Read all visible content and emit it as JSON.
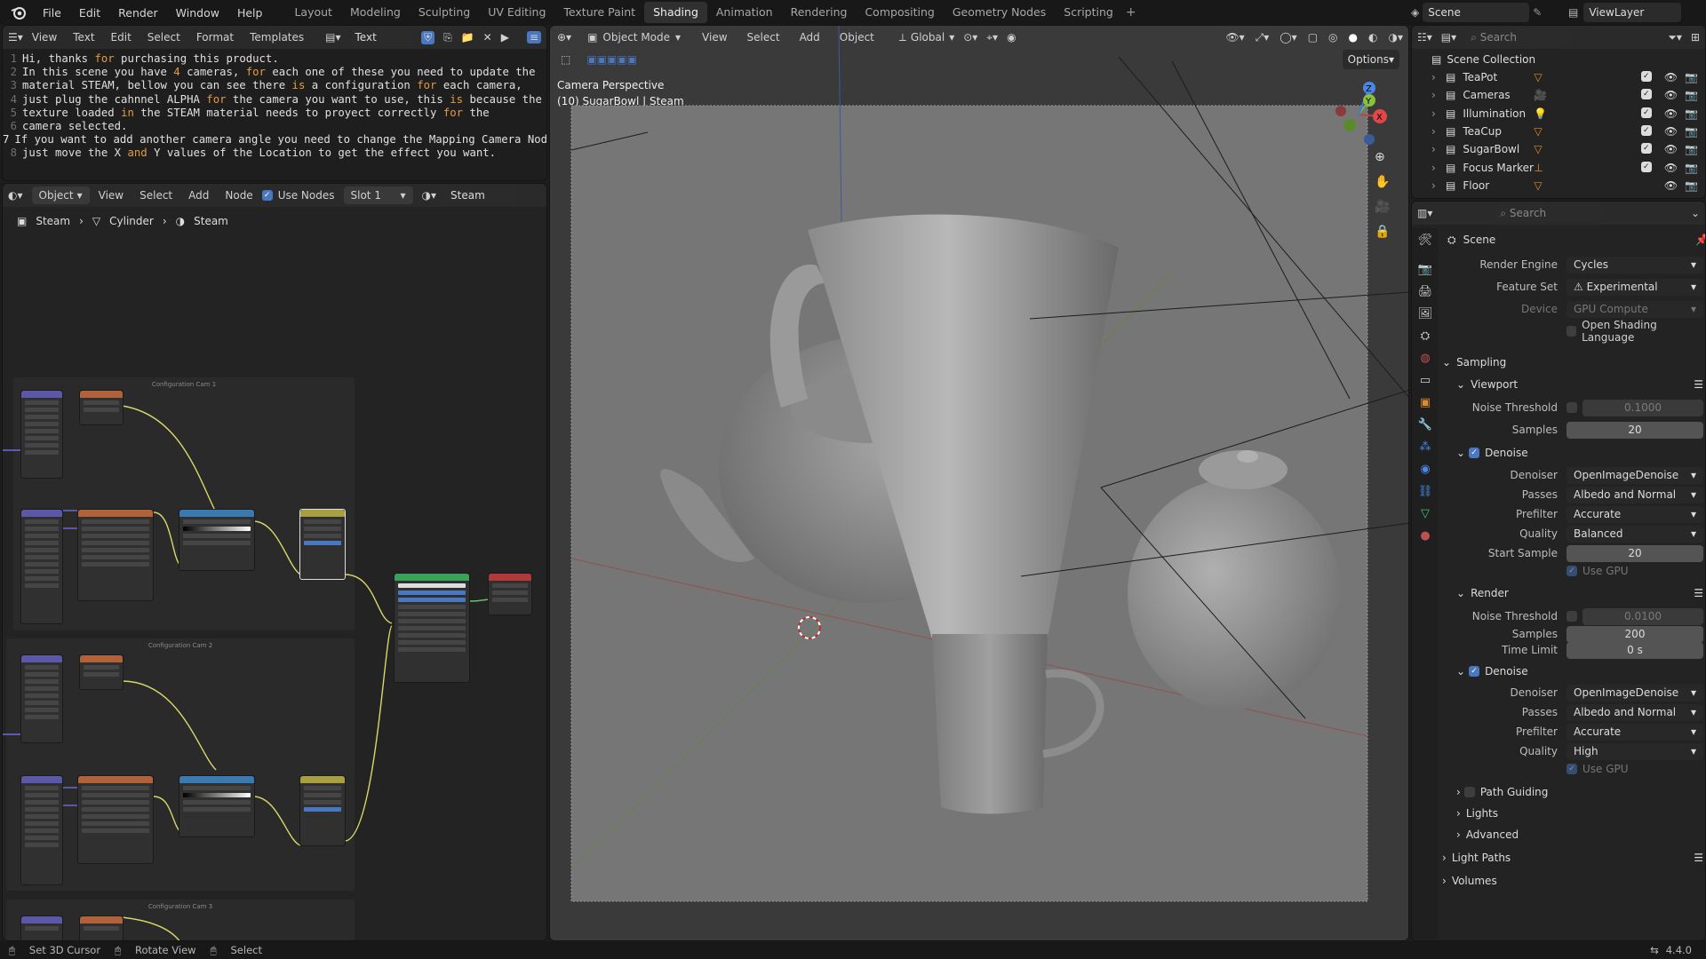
{
  "top_menu": [
    "File",
    "Edit",
    "Render",
    "Window",
    "Help"
  ],
  "workspaces": [
    "Layout",
    "Modeling",
    "Sculpting",
    "UV Editing",
    "Texture Paint",
    "Shading",
    "Animation",
    "Rendering",
    "Compositing",
    "Geometry Nodes",
    "Scripting"
  ],
  "active_workspace": "Shading",
  "scene_name": "Scene",
  "view_layer": "ViewLayer",
  "text_editor": {
    "menu": [
      "View",
      "Text",
      "Edit",
      "Select",
      "Format",
      "Templates"
    ],
    "datablock": "Text",
    "lines": [
      {
        "n": "1",
        "segments": [
          {
            "t": "Hi, thanks "
          },
          {
            "t": "for",
            "k": true
          },
          {
            "t": " purchasing this product."
          }
        ]
      },
      {
        "n": "2",
        "segments": [
          {
            "t": "In this scene you have "
          },
          {
            "t": "4",
            "k": true
          },
          {
            "t": " cameras, "
          },
          {
            "t": "for",
            "k": true
          },
          {
            "t": " each one of these you need to update the"
          }
        ]
      },
      {
        "n": "3",
        "segments": [
          {
            "t": "material STEAM, bellow you can see there "
          },
          {
            "t": "is",
            "k": true
          },
          {
            "t": " a configuration "
          },
          {
            "t": "for",
            "k": true
          },
          {
            "t": " each camera,"
          }
        ]
      },
      {
        "n": "4",
        "segments": [
          {
            "t": "just plug the cahnnel ALPHA "
          },
          {
            "t": "for",
            "k": true
          },
          {
            "t": " the camera you want to use, this "
          },
          {
            "t": "is",
            "k": true
          },
          {
            "t": " because the"
          }
        ]
      },
      {
        "n": "5",
        "segments": [
          {
            "t": "texture loaded "
          },
          {
            "t": "in",
            "k": true
          },
          {
            "t": " the STEAM material needs to proyect correctly "
          },
          {
            "t": "for",
            "k": true
          },
          {
            "t": " the"
          }
        ]
      },
      {
        "n": "6",
        "segments": [
          {
            "t": "camera selected."
          }
        ]
      },
      {
        "n": "7",
        "segments": [
          {
            "t": "If you want to add another camera angle you need to change the Mapping Camera Node"
          }
        ],
        "current": true
      },
      {
        "n": "8",
        "segments": [
          {
            "t": "just move the X "
          },
          {
            "t": "and",
            "k": true
          },
          {
            "t": " Y values of the Location to get the effect you want."
          }
        ]
      }
    ]
  },
  "node_editor": {
    "header": {
      "mode": "Object",
      "menu": [
        "View",
        "Select",
        "Add",
        "Node"
      ],
      "use_nodes_label": "Use Nodes",
      "slot": "Slot 1",
      "material": "Steam"
    },
    "breadcrumb": [
      "Steam",
      "Cylinder",
      "Steam"
    ],
    "frames": [
      "Configuration Cam 1",
      "Configuration Cam 2",
      "Configuration Cam 3"
    ]
  },
  "viewport": {
    "mode": "Object Mode",
    "menu": [
      "View",
      "Select",
      "Add",
      "Object"
    ],
    "orientation": "Global",
    "options_label": "Options",
    "overlay_title": "Camera Perspective",
    "overlay_subtitle": "(10) SugarBowl | Steam"
  },
  "outliner": {
    "search_placeholder": "Search",
    "root": "Scene Collection",
    "items": [
      {
        "name": "TeaPot",
        "icon": "mesh-icon"
      },
      {
        "name": "Cameras",
        "icon": "camera-icon"
      },
      {
        "name": "Illumination",
        "icon": "light-icon"
      },
      {
        "name": "TeaCup",
        "icon": "mesh-icon"
      },
      {
        "name": "SugarBowl",
        "icon": "mesh-icon"
      },
      {
        "name": "Focus Marker",
        "icon": "empty-icon"
      },
      {
        "name": "Floor",
        "icon": "mesh-icon"
      }
    ]
  },
  "properties": {
    "search_placeholder": "Search",
    "context": "Scene",
    "render_engine": {
      "label": "Render Engine",
      "value": "Cycles"
    },
    "feature_set": {
      "label": "Feature Set",
      "value": "Experimental"
    },
    "device": {
      "label": "Device",
      "value": "GPU Compute"
    },
    "osl": "Open Shading Language",
    "sampling": "Sampling",
    "viewport_section": "Viewport",
    "vp_noise": {
      "label": "Noise Threshold",
      "value": "0.1000"
    },
    "vp_samples": {
      "label": "Samples",
      "value": "20"
    },
    "vp_denoise": "Denoise",
    "vp_denoiser": {
      "label": "Denoiser",
      "value": "OpenImageDenoise"
    },
    "vp_passes": {
      "label": "Passes",
      "value": "Albedo and Normal"
    },
    "vp_prefilter": {
      "label": "Prefilter",
      "value": "Accurate"
    },
    "vp_quality": {
      "label": "Quality",
      "value": "Balanced"
    },
    "vp_start": {
      "label": "Start Sample",
      "value": "20"
    },
    "vp_usegpu": "Use GPU",
    "render_section": "Render",
    "r_noise": {
      "label": "Noise Threshold",
      "value": "0.0100"
    },
    "r_samples": {
      "label": "Samples",
      "value": "200"
    },
    "r_timelimit": {
      "label": "Time Limit",
      "value": "0 s"
    },
    "r_denoise": "Denoise",
    "r_denoiser": {
      "label": "Denoiser",
      "value": "OpenImageDenoise"
    },
    "r_passes": {
      "label": "Passes",
      "value": "Albedo and Normal"
    },
    "r_prefilter": {
      "label": "Prefilter",
      "value": "Accurate"
    },
    "r_quality": {
      "label": "Quality",
      "value": "High"
    },
    "r_usegpu": "Use GPU",
    "path_guiding": "Path Guiding",
    "lights": "Lights",
    "advanced": "Advanced",
    "light_paths": "Light Paths",
    "volumes": "Volumes"
  },
  "statusbar": {
    "items": [
      "Set 3D Cursor",
      "Rotate View",
      "Select"
    ],
    "version": "4.4.0"
  }
}
